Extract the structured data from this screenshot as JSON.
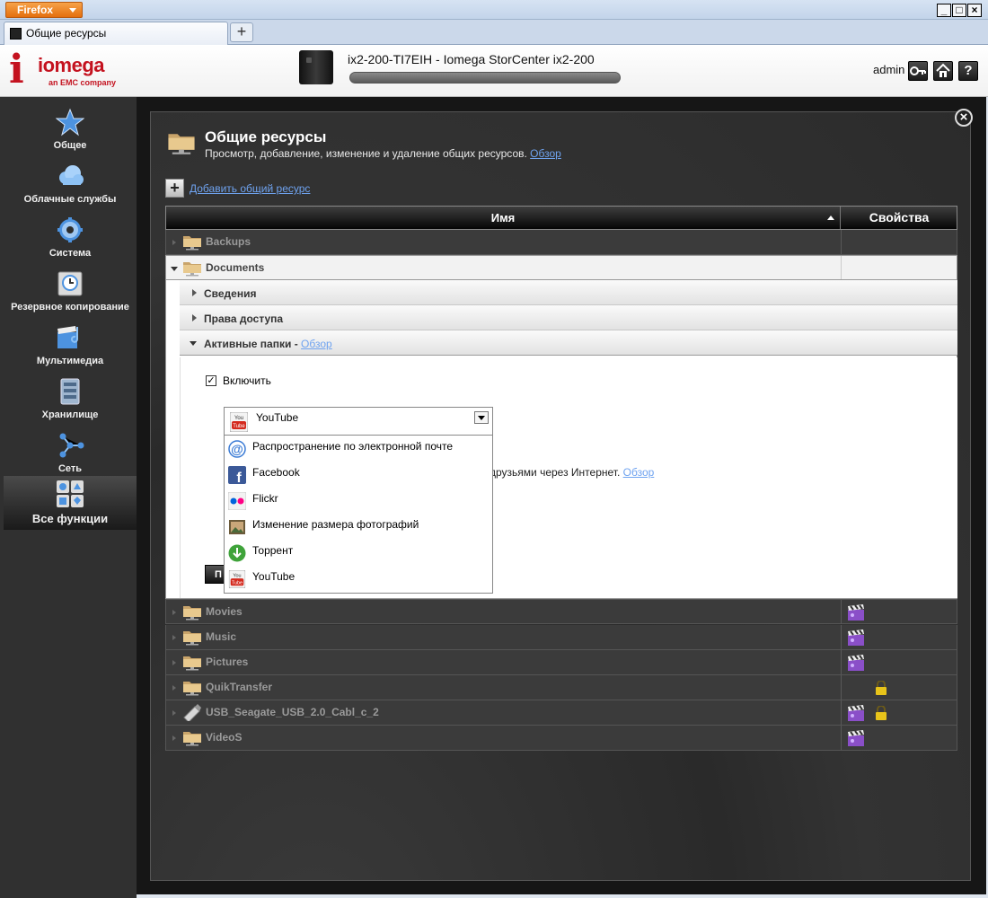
{
  "browser": {
    "menu_label": "Firefox",
    "tab_title": "Общие ресурсы",
    "new_tab": "+",
    "win_min": "_",
    "win_max": "□",
    "win_close": "×"
  },
  "header": {
    "logo_brand": "iomega",
    "logo_sub": "an EMC company",
    "device_title": "ix2-200-TI7EIH - Iomega StorCenter ix2-200",
    "user": "admin",
    "help": "?"
  },
  "sidebar": {
    "items": [
      {
        "label": "Общее",
        "icon": "star-icon"
      },
      {
        "label": "Облачные службы",
        "icon": "cloud-icon"
      },
      {
        "label": "Система",
        "icon": "gear-icon"
      },
      {
        "label": "Резервное копирование",
        "icon": "backup-icon"
      },
      {
        "label": "Мультимедиа",
        "icon": "media-icon"
      },
      {
        "label": "Хранилище",
        "icon": "storage-icon"
      },
      {
        "label": "Сеть",
        "icon": "network-icon"
      },
      {
        "label": "Все функции",
        "icon": "all-features-icon"
      }
    ]
  },
  "page": {
    "close": "×",
    "title": "Общие ресурсы",
    "subtitle": "Просмотр, добавление, изменение и удаление общих ресурсов.",
    "overview_link": "Обзор",
    "add_share": "Добавить общий ресурс"
  },
  "table": {
    "col_name": "Имя",
    "col_props": "Свойства",
    "rows": [
      {
        "name": "Backups",
        "icon": "share-folder-icon",
        "media": false,
        "locked": false
      },
      {
        "name": "Documents",
        "icon": "share-folder-icon",
        "expanded": true
      },
      {
        "name": "Movies",
        "icon": "share-folder-icon",
        "media": true,
        "locked": false
      },
      {
        "name": "Music",
        "icon": "share-folder-icon",
        "media": true,
        "locked": false
      },
      {
        "name": "Pictures",
        "icon": "share-folder-icon",
        "media": true,
        "locked": false
      },
      {
        "name": "QuikTransfer",
        "icon": "share-folder-icon",
        "media": false,
        "locked": true
      },
      {
        "name": "USB_Seagate_USB_2.0_Cabl_c_2",
        "icon": "usb-drive-icon",
        "media": true,
        "locked": true
      },
      {
        "name": "VideoS",
        "icon": "share-folder-icon",
        "media": true,
        "locked": false
      }
    ]
  },
  "documents": {
    "sections": {
      "info": "Сведения",
      "access": "Права доступа",
      "active_folders": "Активные папки -",
      "active_folders_link": "Обзор"
    },
    "enable_label": "Включить",
    "enable_checked": true,
    "partial_desc": "друзьями через Интернет.",
    "partial_link": "Обзор",
    "partial_button": "П",
    "select": {
      "value": "YouTube",
      "options": [
        {
          "label": "Распространение по электронной почте",
          "icon": "email-at-icon"
        },
        {
          "label": "Facebook",
          "icon": "facebook-icon"
        },
        {
          "label": "Flickr",
          "icon": "flickr-icon"
        },
        {
          "label": "Изменение размера фотографий",
          "icon": "photo-resize-icon"
        },
        {
          "label": "Торрент",
          "icon": "torrent-icon"
        },
        {
          "label": "YouTube",
          "icon": "youtube-icon"
        }
      ]
    }
  },
  "colors": {
    "brand_red": "#c4121f",
    "link_blue": "#6fa3f0",
    "panel_dark": "#2b2b2b"
  }
}
